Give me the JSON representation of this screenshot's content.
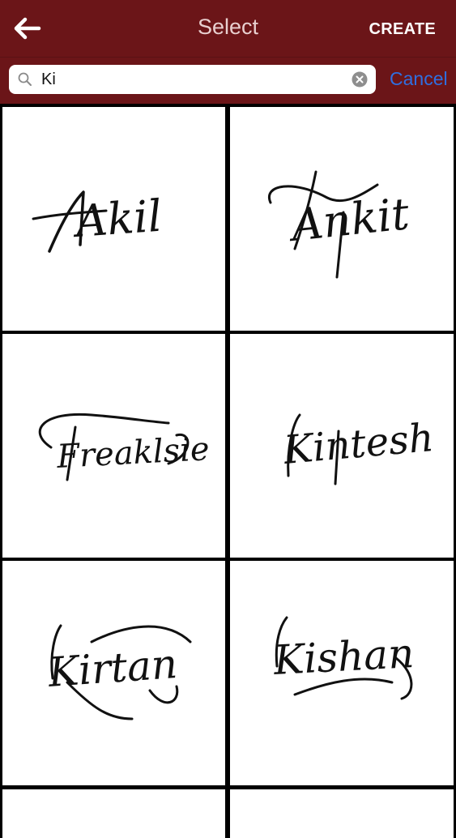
{
  "header": {
    "title": "Select",
    "create_label": "CREATE"
  },
  "search": {
    "value": "Ki",
    "cancel_label": "Cancel"
  },
  "signatures": [
    {
      "name": "Akil"
    },
    {
      "name": "Ankit"
    },
    {
      "name": "Freaklsie"
    },
    {
      "name": "Kintesh"
    },
    {
      "name": "Kirtan"
    },
    {
      "name": "Kishan"
    }
  ],
  "colors": {
    "header_bg": "#6b1518",
    "cancel": "#2f6fe0"
  }
}
